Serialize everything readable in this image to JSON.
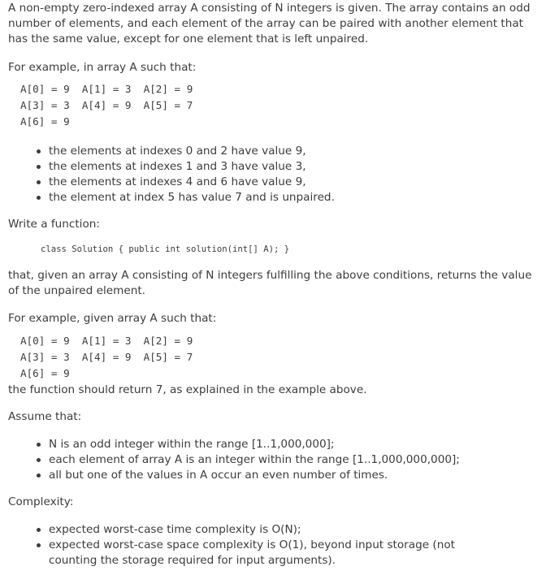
{
  "intro": "A non-empty zero-indexed array A consisting of N integers is given. The array contains an odd number of elements, and each element of the array can be paired with another element that has the same value, except for one element that is left unpaired.",
  "example_intro": "For example, in array A such that:",
  "example1_lines": [
    "A[0] = 9  A[1] = 3  A[2] = 9",
    "A[3] = 3  A[4] = 9  A[5] = 7",
    "A[6] = 9"
  ],
  "bullets1": [
    "the elements at indexes 0 and 2 have value 9,",
    "the elements at indexes 1 and 3 have value 3,",
    "the elements at indexes 4 and 6 have value 9,",
    "the element at index 5 has value 7 and is unpaired."
  ],
  "write_function": "Write a function:",
  "signature": "class Solution { public int solution(int[] A); }",
  "task": "that, given an array A consisting of N integers fulfilling the above conditions, returns the value of the unpaired element.",
  "example2_intro": "For example, given array A such that:",
  "example2_lines": [
    "A[0] = 9  A[1] = 3  A[2] = 9",
    "A[3] = 3  A[4] = 9  A[5] = 7",
    "A[6] = 9"
  ],
  "return_text": "the function should return 7, as explained in the example above.",
  "assume": "Assume that:",
  "bullets2": [
    "N is an odd integer within the range [1..1,000,000];",
    "each element of array A is an integer within the range [1..1,000,000,000];",
    "all but one of the values in A occur an even number of times."
  ],
  "complexity": "Complexity:",
  "bullets3": [
    "expected worst-case time complexity is O(N);",
    "expected worst-case space complexity is O(1), beyond input storage (not counting the storage required for input arguments)."
  ]
}
